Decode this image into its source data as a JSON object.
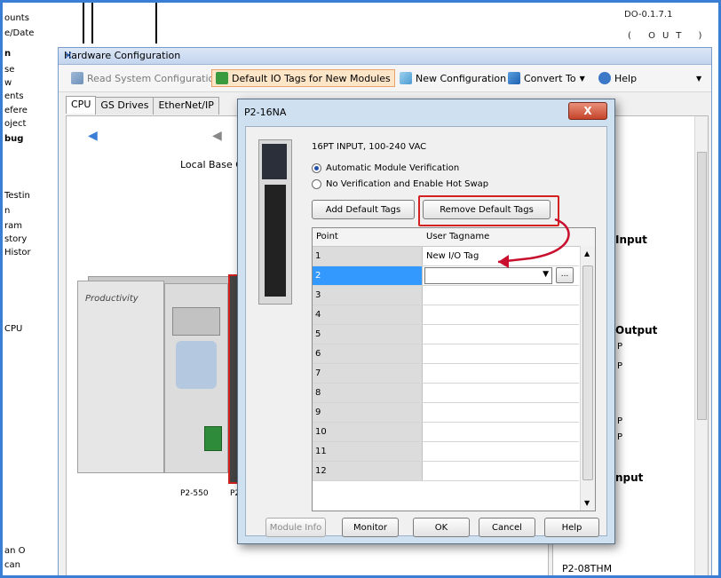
{
  "background": {
    "left_items": [
      "ounts",
      "e/Date",
      "n",
      "se",
      "w",
      "ents",
      "efere",
      "oject",
      "bug",
      "Testin",
      "n",
      "ram",
      "story",
      "Histor",
      "CPU",
      "an O",
      "can"
    ],
    "top_ref": "DO-0.1.7.1",
    "top_out": "( OUT )"
  },
  "hw_window": {
    "title": "Hardware Configuration",
    "close": "×",
    "toolbar": {
      "read_system": "Read System Configuration",
      "default_io": "Default IO Tags for New Modules",
      "new_config": "New Configuration",
      "convert_to": "Convert To",
      "help": "Help"
    },
    "tabs": [
      "CPU",
      "GS Drives",
      "EtherNet/IP"
    ],
    "cpu_panel": {
      "local_base": "Local Base Gr",
      "brand": "Productivity",
      "module_labels": [
        "P2-550",
        "P2"
      ]
    },
    "right_panel": {
      "input_label": "Input",
      "output_label": "Output",
      "input2_label": "nput",
      "p_letters": [
        "P",
        "P",
        "P",
        "P"
      ],
      "footer": "P2-08THM"
    },
    "colors": {
      "accent": "#3a7fd5",
      "highlight_red": "#d32020",
      "selection": "#3399ff"
    }
  },
  "dialog": {
    "title": "P2-16NA",
    "close_label": "X",
    "description": "16PT INPUT, 100-240 VAC",
    "radio_auto": "Automatic Module Verification",
    "radio_none": "No Verification and Enable Hot Swap",
    "add_default_tags": "Add Default Tags",
    "remove_default_tags": "Remove Default Tags",
    "grid": {
      "col_point": "Point",
      "col_tagname": "User Tagname",
      "rows": [
        {
          "point": "1",
          "tag": "New I/O Tag"
        },
        {
          "point": "2",
          "tag": ""
        },
        {
          "point": "3",
          "tag": ""
        },
        {
          "point": "4",
          "tag": ""
        },
        {
          "point": "5",
          "tag": ""
        },
        {
          "point": "6",
          "tag": ""
        },
        {
          "point": "7",
          "tag": ""
        },
        {
          "point": "8",
          "tag": ""
        },
        {
          "point": "9",
          "tag": ""
        },
        {
          "point": "10",
          "tag": ""
        },
        {
          "point": "11",
          "tag": ""
        },
        {
          "point": "12",
          "tag": ""
        }
      ],
      "ellipsis": "..."
    },
    "buttons": {
      "module_info": "Module Info",
      "monitor": "Monitor",
      "ok": "OK",
      "cancel": "Cancel",
      "help": "Help"
    }
  }
}
